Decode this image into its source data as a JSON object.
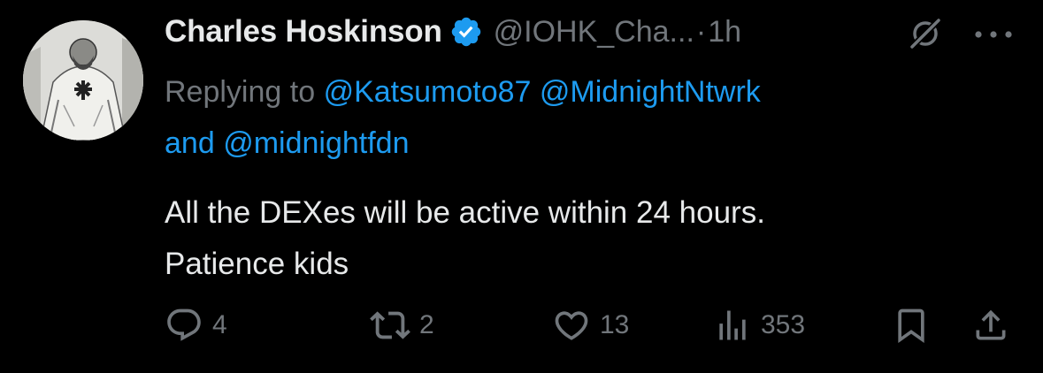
{
  "tweet": {
    "author_name": "Charles Hoskinson",
    "handle": "@IOHK_Cha...",
    "separator": "·",
    "time": "1h",
    "replying_prefix": "Replying to",
    "mention_1": "@Katsumoto87",
    "mention_2": "@MidnightNtwrk",
    "and_word": "and",
    "mention_3": "@midnightfdn",
    "text_line_1": "All the DEXes will be active within 24 hours.",
    "text_line_2": "Patience kids"
  },
  "icons": {
    "verified": "verified-badge-icon",
    "grok": "grok-icon",
    "more": "more-icon",
    "reply": "reply-icon",
    "retweet": "retweet-icon",
    "like": "heart-icon",
    "views": "views-icon",
    "bookmark": "bookmark-icon",
    "share": "share-icon"
  },
  "actions": {
    "replies": "4",
    "retweets": "2",
    "likes": "13",
    "views": "353"
  },
  "colors": {
    "background": "#000000",
    "text_primary": "#e7e9ea",
    "text_secondary": "#71767b",
    "accent": "#1d9bf0"
  }
}
